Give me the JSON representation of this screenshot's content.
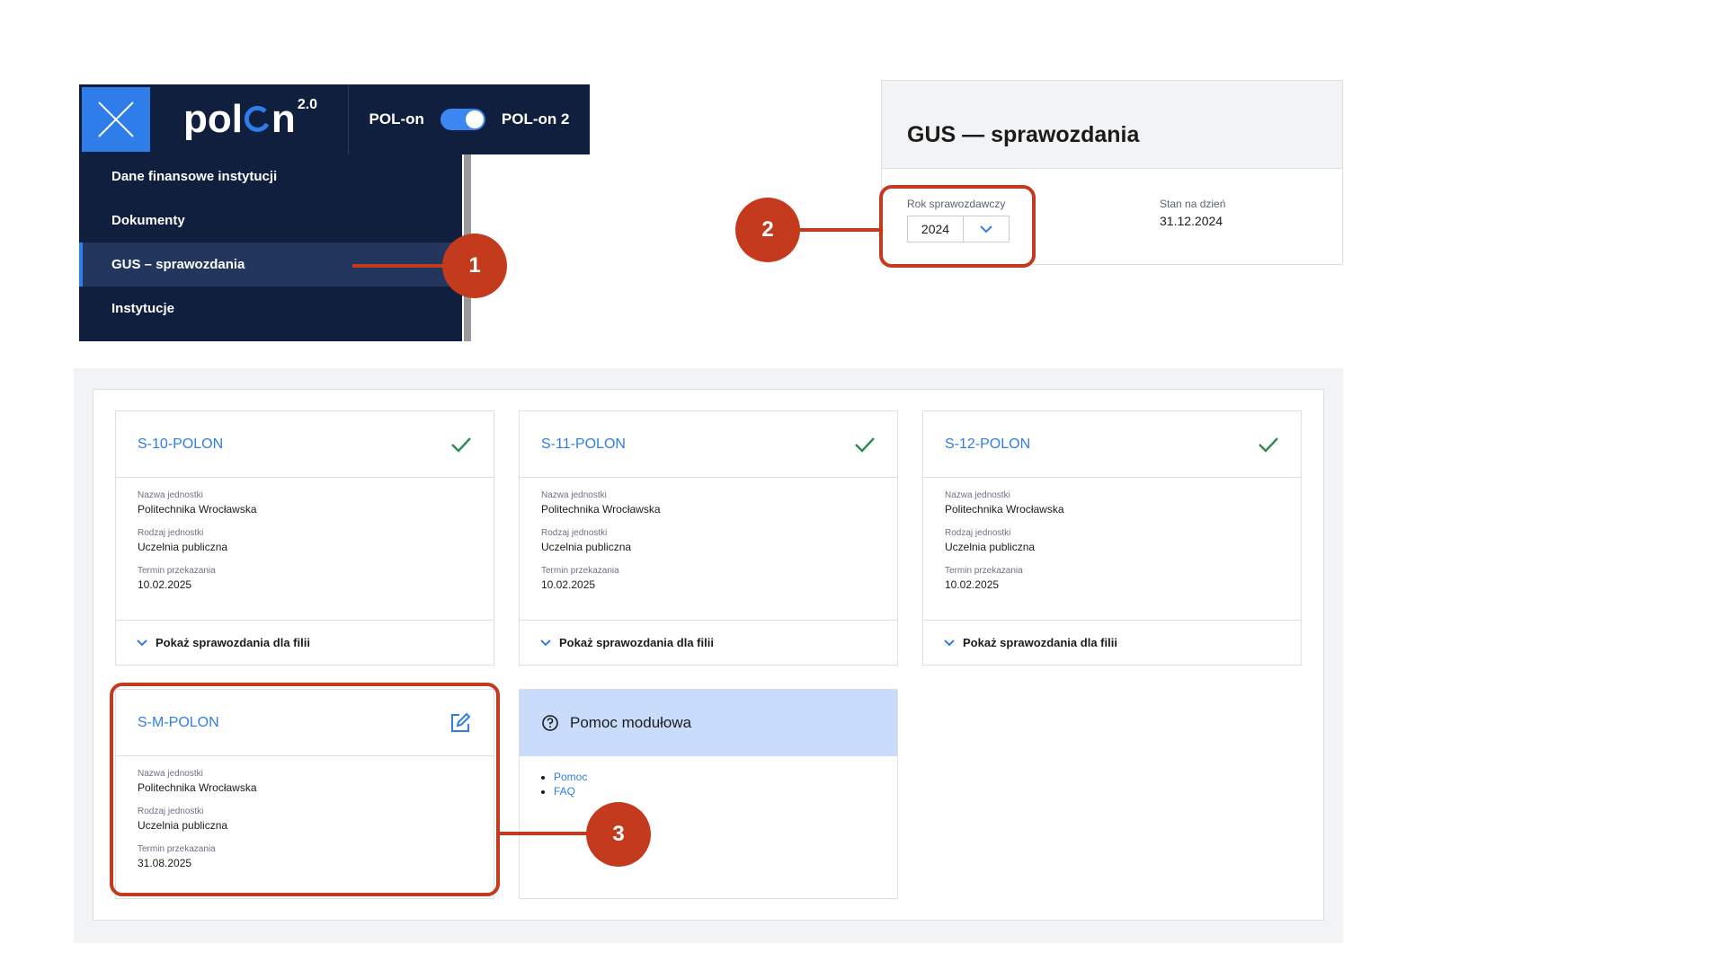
{
  "menu": {
    "logo": "pol",
    "logo_tail": "n",
    "logo_version": "2.0",
    "switch_left": "POL-on",
    "switch_right": "POL-on 2",
    "items": [
      {
        "label": "Dane finansowe instytucji"
      },
      {
        "label": "Dokumenty"
      },
      {
        "label": "GUS – sprawozdania"
      },
      {
        "label": "Instytucje"
      }
    ]
  },
  "header": {
    "title": "GUS — sprawozdania",
    "year_label": "Rok sprawozdawczy",
    "year_value": "2024",
    "date_label": "Stan na dzień",
    "date_value": "31.12.2024"
  },
  "field_labels": {
    "unit_name": "Nazwa jednostki",
    "unit_type": "Rodzaj jednostki",
    "deadline": "Termin przekazania"
  },
  "cards": [
    {
      "title": "S-10-POLON",
      "unit_name": "Politechnika Wrocławska",
      "unit_type": "Uczelnia publiczna",
      "deadline": "10.02.2025",
      "footer": "Pokaż sprawozdania dla filii",
      "status_icon": "check-icon"
    },
    {
      "title": "S-11-POLON",
      "unit_name": "Politechnika Wrocławska",
      "unit_type": "Uczelnia publiczna",
      "deadline": "10.02.2025",
      "footer": "Pokaż sprawozdania dla filii",
      "status_icon": "check-icon"
    },
    {
      "title": "S-12-POLON",
      "unit_name": "Politechnika Wrocławska",
      "unit_type": "Uczelnia publiczna",
      "deadline": "10.02.2025",
      "footer": "Pokaż sprawozdania dla filii",
      "status_icon": "check-icon"
    },
    {
      "title": "S-M-POLON",
      "unit_name": "Politechnika Wrocławska",
      "unit_type": "Uczelnia publiczna",
      "deadline": "31.08.2025",
      "status_icon": "edit-icon"
    }
  ],
  "help": {
    "title": "Pomoc modułowa",
    "links": [
      "Pomoc",
      "FAQ"
    ]
  },
  "annotations": [
    "1",
    "2",
    "3"
  ],
  "colors": {
    "navy": "#0f1f3d",
    "accent_blue": "#2f7de9",
    "annotation_red": "#c43a1d",
    "check_green": "#2e8b57",
    "help_header": "#cadcfb"
  }
}
